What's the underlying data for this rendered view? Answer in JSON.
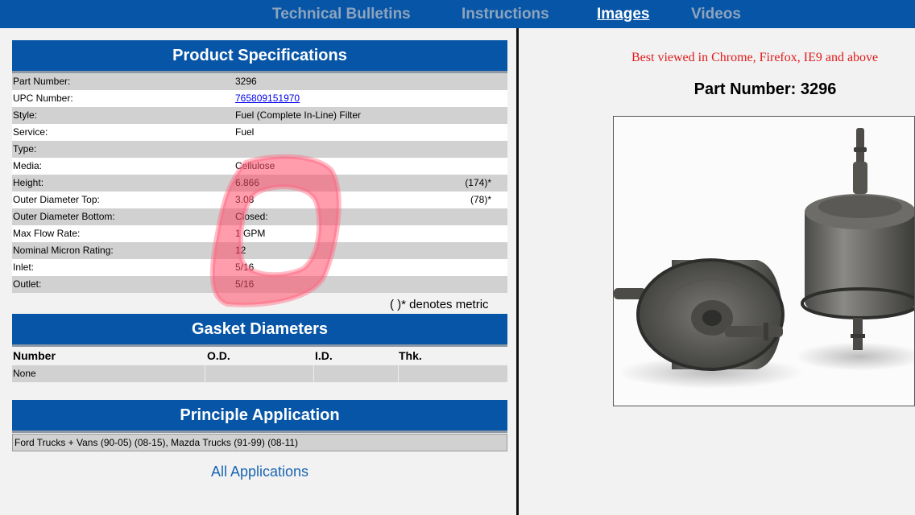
{
  "nav": {
    "items": [
      {
        "label": "Technical Bulletins",
        "active": false
      },
      {
        "label": "Instructions",
        "active": false
      },
      {
        "label": "Images",
        "active": true
      },
      {
        "label": "Videos",
        "active": false
      }
    ]
  },
  "specs": {
    "title": "Product Specifications",
    "rows": [
      {
        "label": "Part Number:",
        "value": "3296",
        "metric": ""
      },
      {
        "label": "UPC Number:",
        "value": "765809151970",
        "metric": ""
      },
      {
        "label": "Style:",
        "value": "Fuel (Complete In-Line) Filter",
        "metric": ""
      },
      {
        "label": "Service:",
        "value": "Fuel",
        "metric": ""
      },
      {
        "label": "Type:",
        "value": "",
        "metric": ""
      },
      {
        "label": "Media:",
        "value": "Cellulose",
        "metric": ""
      },
      {
        "label": "Height:",
        "value": "6.866",
        "metric": "(174)*"
      },
      {
        "label": "Outer Diameter Top:",
        "value": "3.08",
        "metric": "(78)*"
      },
      {
        "label": "Outer Diameter Bottom:",
        "value": "Closed:",
        "metric": ""
      },
      {
        "label": "Max Flow Rate:",
        "value": "1 GPM",
        "metric": ""
      },
      {
        "label": "Nominal Micron Rating:",
        "value": "12",
        "metric": ""
      },
      {
        "label": "Inlet:",
        "value": "5/16",
        "metric": ""
      },
      {
        "label": "Outlet:",
        "value": "5/16",
        "metric": ""
      }
    ],
    "metric_note": "(   )* denotes metric"
  },
  "gasket": {
    "title": "Gasket Diameters",
    "columns": [
      "Number",
      "O.D.",
      "I.D.",
      "Thk."
    ],
    "rows": [
      [
        "None",
        "",
        "",
        ""
      ]
    ]
  },
  "application": {
    "title": "Principle Application",
    "text": "Ford Trucks + Vans (90-05) (08-15), Mazda Trucks (91-99) (08-11)",
    "all_link": "All Applications"
  },
  "right": {
    "browser_note": "Best viewed in Chrome, Firefox, IE9 and above",
    "part_title": "Part Number: 3296"
  },
  "colors": {
    "nav_bg": "#0755a7",
    "header_bg": "#0755a7",
    "row_shade": "#d1d1d1",
    "note_red": "#e01b1b",
    "marker": "#ff4d6a"
  }
}
